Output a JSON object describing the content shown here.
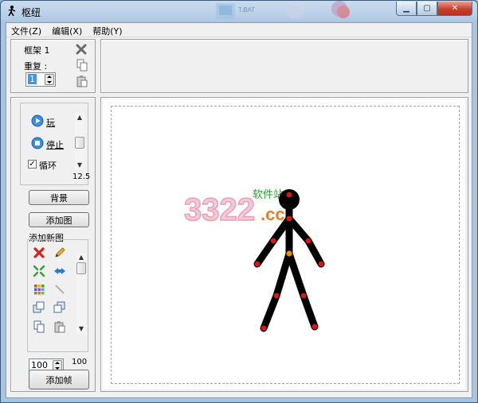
{
  "window": {
    "title": "枢纽",
    "controls": [
      "minimize",
      "maximize",
      "close"
    ]
  },
  "menubar": {
    "items": [
      "文件(Z)",
      "编辑(X)",
      "帮助(Y)"
    ]
  },
  "frame_panel": {
    "frame_label": "框架 1",
    "repeat_label": "重复 :",
    "repeat_value": "1"
  },
  "playback": {
    "play_label": "玩",
    "stop_label": "停止",
    "loop_label": "循环",
    "loop_checked": true,
    "speed_value": "12.5"
  },
  "buttons": {
    "background": "背景",
    "add_image": "添加图",
    "add_frame": "添加帧"
  },
  "figures": {
    "heading": "添加新图",
    "scale_value": "100",
    "scroll_value": "100"
  },
  "watermark": {
    "number": "3322",
    "domain": ".cc",
    "site": "软件站"
  },
  "colors": {
    "figure_line": "#000000",
    "joint": "#d81818",
    "root_joint": "#f08c00",
    "accent": "#1a6fd0"
  }
}
